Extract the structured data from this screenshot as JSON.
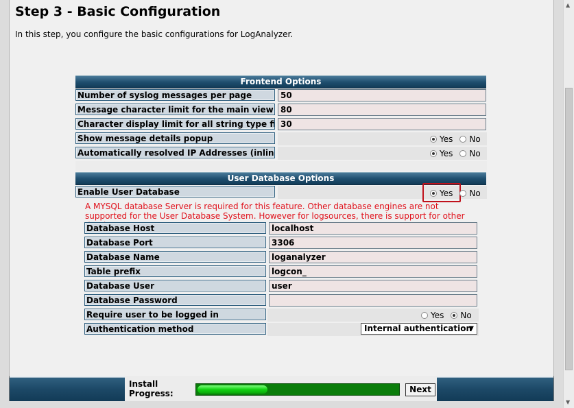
{
  "page": {
    "title": "Step 3 - Basic Configuration",
    "description": "In this step, you configure the basic configurations for LogAnalyzer."
  },
  "frontend": {
    "header": "Frontend Options",
    "rows": [
      {
        "label": "Number of syslog messages per page",
        "value": "50"
      },
      {
        "label": "Message character limit for the main view",
        "value": "80"
      },
      {
        "label": "Character display limit for all string type fields",
        "value": "30"
      }
    ],
    "popup": {
      "label": "Show message details popup",
      "selected": "Yes"
    },
    "resolve_ip": {
      "label": "Automatically resolved IP Addresses (inline)",
      "selected": "Yes"
    },
    "yes_label": "Yes",
    "no_label": "No"
  },
  "userdb": {
    "header": "User Database Options",
    "enable": {
      "label": "Enable User Database",
      "selected": "Yes"
    },
    "warning": "A MYSQL database Server is required for this feature. Other database engines are not supported for the User Database System. However for logsources, there is support for other database systems.",
    "rows": [
      {
        "label": "Database Host",
        "value": "localhost"
      },
      {
        "label": "Database Port",
        "value": "3306"
      },
      {
        "label": "Database Name",
        "value": "loganalyzer"
      },
      {
        "label": "Table prefix",
        "value": "logcon_"
      },
      {
        "label": "Database User",
        "value": "user"
      },
      {
        "label": "Database Password",
        "value": ""
      }
    ],
    "require_login": {
      "label": "Require user to be logged in",
      "selected": "No"
    },
    "auth": {
      "label": "Authentication method",
      "value": "Internal authentication"
    }
  },
  "footer": {
    "progress_label": "Install Progress:",
    "progress_fraction": 0.35,
    "next_label": "Next"
  },
  "colors": {
    "header_blue": "#1f4f6f",
    "label_bg": "#cfd8e0",
    "value_bg": "#efe4e4",
    "warning_red": "#e0101a",
    "highlight_red": "#c0121c",
    "progress_green": "#12d312"
  }
}
